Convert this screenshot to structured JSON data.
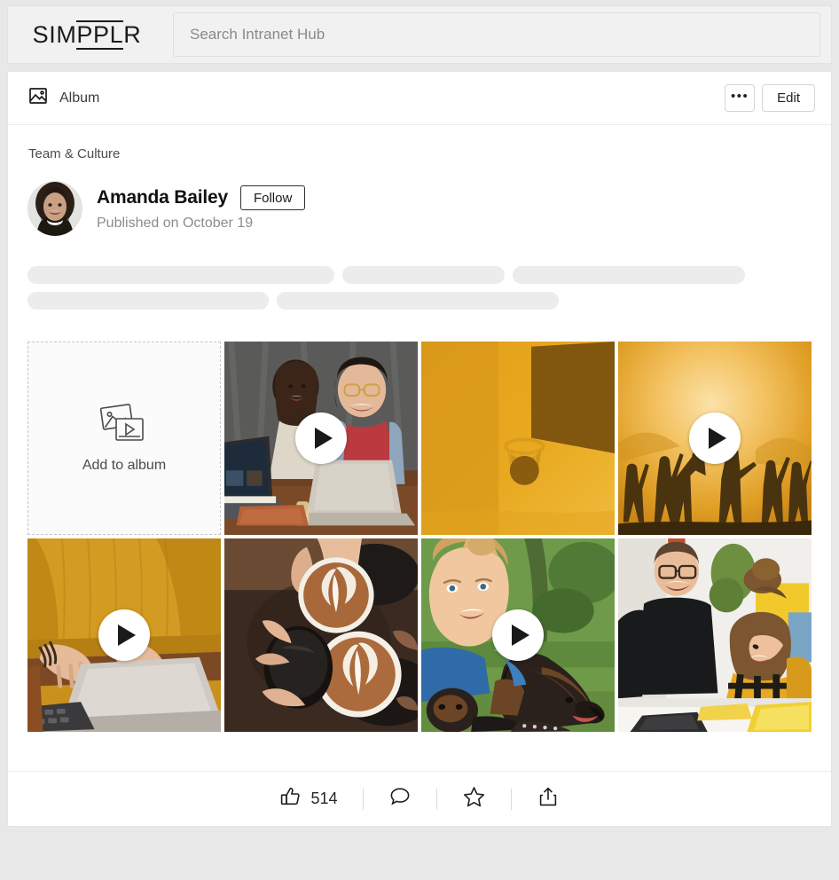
{
  "brand": {
    "logo_prefix": "SIM",
    "logo_mark": "PPL",
    "logo_suffix": "R"
  },
  "search": {
    "placeholder": "Search Intranet Hub",
    "value": "",
    "icon": "search-icon"
  },
  "content_header": {
    "type_icon": "image-icon",
    "type_label": "Album",
    "more_label": "•••",
    "edit_label": "Edit"
  },
  "post": {
    "breadcrumb": "Team & Culture",
    "author_name": "Amanda Bailey",
    "follow_label": "Follow",
    "published": "Published on October 19",
    "avatar_alt": "Amanda Bailey avatar"
  },
  "body_skeleton": {
    "rows": [
      [
        346,
        183,
        262
      ],
      [
        272,
        318
      ]
    ]
  },
  "album": {
    "add_tile": {
      "label": "Add to album",
      "icon": "add-media-icon"
    },
    "tiles": [
      {
        "id": "tile-add",
        "kind": "add",
        "alt": "Add to album"
      },
      {
        "id": "tile-laptop-pair",
        "kind": "video",
        "alt": "Two colleagues laughing at laptops",
        "play": true
      },
      {
        "id": "tile-basketball",
        "kind": "photo",
        "alt": "Basketball hoop against golden sky",
        "play": false
      },
      {
        "id": "tile-sunset-cheer",
        "kind": "video",
        "alt": "Silhouettes of people cheering at sunset",
        "play": true
      },
      {
        "id": "tile-typing",
        "kind": "video",
        "alt": "Person in mustard sweater typing on laptop",
        "play": true
      },
      {
        "id": "tile-coffee",
        "kind": "photo",
        "alt": "Hands holding coffee cups with latte art",
        "play": false
      },
      {
        "id": "tile-dog",
        "kind": "video",
        "alt": "Woman smiling with dachshund dogs",
        "play": true
      },
      {
        "id": "tile-office-pair",
        "kind": "photo",
        "alt": "Two colleagues working at a table",
        "play": false
      }
    ]
  },
  "actions": {
    "like": {
      "icon": "thumbs-up-icon",
      "count": "514"
    },
    "comment": {
      "icon": "comment-icon"
    },
    "favorite": {
      "icon": "star-icon"
    },
    "share": {
      "icon": "share-icon"
    }
  },
  "colors": {
    "page_background": "#e8e8e8",
    "card_background": "#ffffff",
    "topbar_background": "#f1f1f1",
    "skeleton": "#ececec",
    "text_primary": "#111111",
    "text_muted": "#8c8c8c",
    "accent_gold": "#e0a21e"
  }
}
